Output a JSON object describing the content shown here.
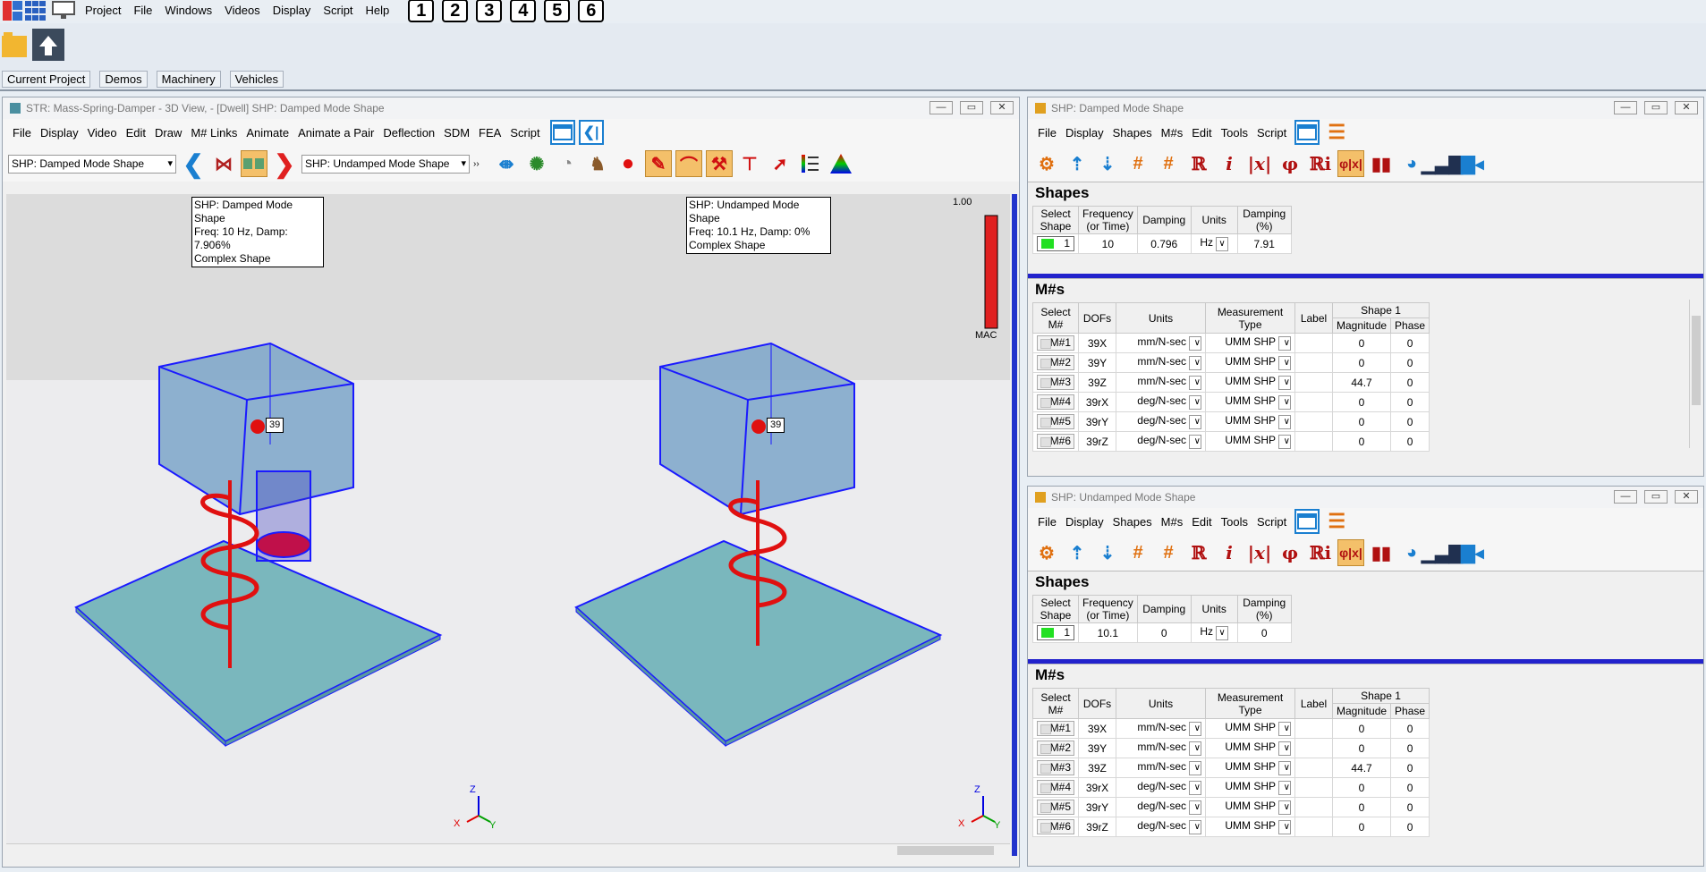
{
  "topmenu": {
    "items": [
      "Project",
      "File",
      "Windows",
      "Videos",
      "Display",
      "Script",
      "Help"
    ],
    "numbers": [
      "1",
      "2",
      "3",
      "4",
      "5",
      "6"
    ]
  },
  "projtabs": [
    "Current Project",
    "Demos",
    "Machinery",
    "Vehicles"
  ],
  "view3d": {
    "title": "STR: Mass-Spring-Damper - 3D View,  - [Dwell] SHP: Damped Mode Shape",
    "menu": [
      "File",
      "Display",
      "Video",
      "Edit",
      "Draw",
      "M# Links",
      "Animate",
      "Animate a Pair",
      "Deflection",
      "SDM",
      "FEA",
      "Script"
    ],
    "left_select": "SHP: Damped Mode Shape",
    "right_select": "SHP: Undamped Mode Shape",
    "tip_left": [
      "SHP: Damped Mode Shape",
      "Freq: 10 Hz, Damp: 7.906%",
      "Complex Shape"
    ],
    "tip_right": [
      "SHP: Undamped Mode Shape",
      "Freq: 10.1 Hz, Damp: 0%",
      "Complex Shape"
    ],
    "mac_value": "1.00",
    "mac_label": "MAC",
    "point_label": "39",
    "axis": {
      "z": "Z",
      "x": "X",
      "y": "Y"
    }
  },
  "shp_damped": {
    "title": "SHP: Damped Mode Shape",
    "menu": [
      "File",
      "Display",
      "Shapes",
      "M#s",
      "Edit",
      "Tools",
      "Script"
    ],
    "shapes_title": "Shapes",
    "shape_headers": [
      "Select Shape",
      "Frequency (or Time)",
      "Damping",
      "Units",
      "Damping (%)"
    ],
    "shape_row": {
      "sel": "1",
      "freq": "10",
      "damp": "0.796",
      "units": "Hz",
      "pct": "7.91"
    },
    "ms_title": "M#s",
    "m_headers": [
      "Select M#",
      "DOFs",
      "Units",
      "Measurement Type",
      "Label",
      "Shape 1",
      "Magnitude",
      "Phase"
    ],
    "rows": [
      {
        "m": "M#1",
        "dof": "39X",
        "u": "mm/N-sec",
        "t": "UMM SHP",
        "mag": "0",
        "ph": "0"
      },
      {
        "m": "M#2",
        "dof": "39Y",
        "u": "mm/N-sec",
        "t": "UMM SHP",
        "mag": "0",
        "ph": "0"
      },
      {
        "m": "M#3",
        "dof": "39Z",
        "u": "mm/N-sec",
        "t": "UMM SHP",
        "mag": "44.7",
        "ph": "0"
      },
      {
        "m": "M#4",
        "dof": "39rX",
        "u": "deg/N-sec",
        "t": "UMM SHP",
        "mag": "0",
        "ph": "0"
      },
      {
        "m": "M#5",
        "dof": "39rY",
        "u": "deg/N-sec",
        "t": "UMM SHP",
        "mag": "0",
        "ph": "0"
      },
      {
        "m": "M#6",
        "dof": "39rZ",
        "u": "deg/N-sec",
        "t": "UMM SHP",
        "mag": "0",
        "ph": "0"
      }
    ]
  },
  "shp_undamped": {
    "title": "SHP: Undamped Mode Shape",
    "menu": [
      "File",
      "Display",
      "Shapes",
      "M#s",
      "Edit",
      "Tools",
      "Script"
    ],
    "shapes_title": "Shapes",
    "shape_headers": [
      "Select Shape",
      "Frequency (or Time)",
      "Damping",
      "Units",
      "Damping (%)"
    ],
    "shape_row": {
      "sel": "1",
      "freq": "10.1",
      "damp": "0",
      "units": "Hz",
      "pct": "0"
    },
    "ms_title": "M#s",
    "m_headers": [
      "Select M#",
      "DOFs",
      "Units",
      "Measurement Type",
      "Label",
      "Shape 1",
      "Magnitude",
      "Phase"
    ],
    "rows": [
      {
        "m": "M#1",
        "dof": "39X",
        "u": "mm/N-sec",
        "t": "UMM SHP",
        "mag": "0",
        "ph": "0"
      },
      {
        "m": "M#2",
        "dof": "39Y",
        "u": "mm/N-sec",
        "t": "UMM SHP",
        "mag": "0",
        "ph": "0"
      },
      {
        "m": "M#3",
        "dof": "39Z",
        "u": "mm/N-sec",
        "t": "UMM SHP",
        "mag": "44.7",
        "ph": "0"
      },
      {
        "m": "M#4",
        "dof": "39rX",
        "u": "deg/N-sec",
        "t": "UMM SHP",
        "mag": "0",
        "ph": "0"
      },
      {
        "m": "M#5",
        "dof": "39rY",
        "u": "deg/N-sec",
        "t": "UMM SHP",
        "mag": "0",
        "ph": "0"
      },
      {
        "m": "M#6",
        "dof": "39rZ",
        "u": "deg/N-sec",
        "t": "UMM SHP",
        "mag": "0",
        "ph": "0"
      }
    ]
  }
}
